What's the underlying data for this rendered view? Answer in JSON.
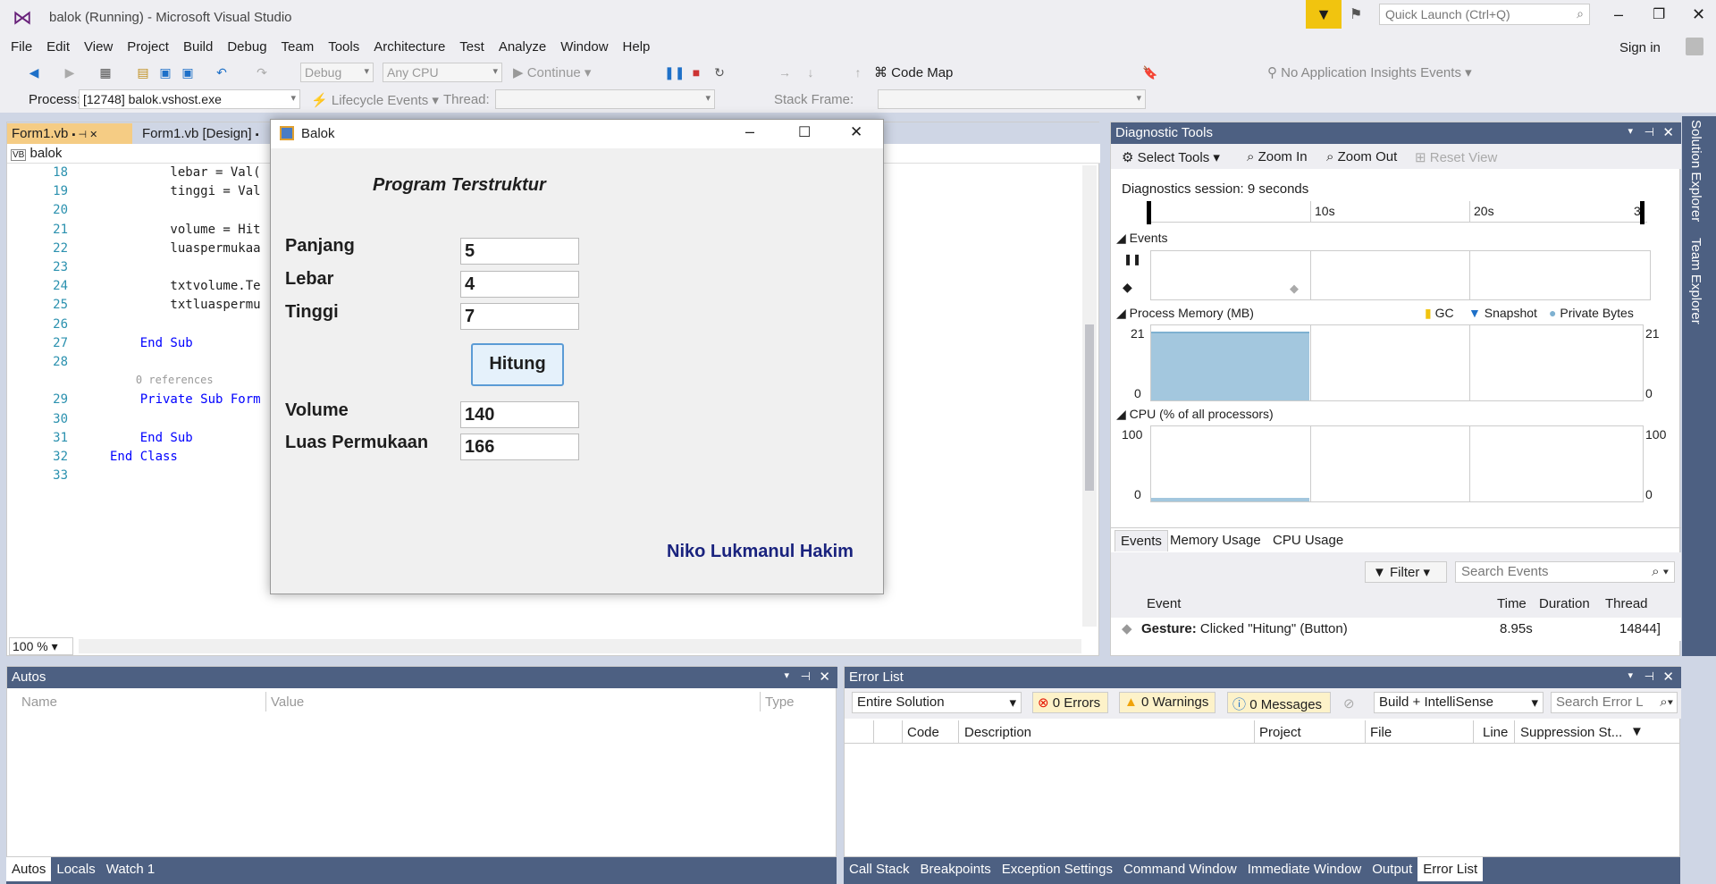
{
  "window": {
    "title": "balok (Running) - Microsoft Visual Studio",
    "quick_launch": "Quick Launch (Ctrl+Q)",
    "sign_in": "Sign in"
  },
  "menu": [
    "File",
    "Edit",
    "View",
    "Project",
    "Build",
    "Debug",
    "Team",
    "Tools",
    "Architecture",
    "Test",
    "Analyze",
    "Window",
    "Help"
  ],
  "toolbar": {
    "config": "Debug",
    "platform": "Any CPU",
    "continue": "Continue",
    "code_map": "Code Map",
    "insights": "No Application Insights Events"
  },
  "debugbar": {
    "process_label": "Process:",
    "process_value": "[12748] balok.vshost.exe",
    "lifecycle": "Lifecycle Events",
    "thread_label": "Thread:",
    "stack_label": "Stack Frame:"
  },
  "editor": {
    "tabs": [
      "Form1.vb",
      "Form1.vb [Design]"
    ],
    "nav_class": "balok",
    "zoom": "100 %",
    "lines": [
      {
        "n": "18",
        "t": "        lebar = Val("
      },
      {
        "n": "19",
        "t": "        tinggi = Val"
      },
      {
        "n": "20",
        "t": ""
      },
      {
        "n": "21",
        "t": "        volume = Hit"
      },
      {
        "n": "22",
        "t": "        luaspermukaa"
      },
      {
        "n": "23",
        "t": ""
      },
      {
        "n": "24",
        "t": "        txtvolume.Te"
      },
      {
        "n": "25",
        "t": "        txtluaspermu"
      },
      {
        "n": "26",
        "t": ""
      },
      {
        "n": "27",
        "t": "    End Sub"
      },
      {
        "n": "28",
        "t": ""
      },
      {
        "n": "",
        "t": "    0 references"
      },
      {
        "n": "29",
        "t": "    Private Sub Form"
      },
      {
        "n": "30",
        "t": ""
      },
      {
        "n": "31",
        "t": "    End Sub"
      },
      {
        "n": "32",
        "t": "End Class"
      },
      {
        "n": "33",
        "t": ""
      }
    ]
  },
  "dialog": {
    "title": "Balok",
    "heading": "Program Terstruktur",
    "fields": [
      {
        "label": "Panjang",
        "value": "5"
      },
      {
        "label": "Lebar",
        "value": "4"
      },
      {
        "label": "Tinggi",
        "value": "7"
      }
    ],
    "button": "Hitung",
    "outputs": [
      {
        "label": "Volume",
        "value": "140"
      },
      {
        "label": "Luas Permukaan",
        "value": "166"
      }
    ],
    "author": "Niko Lukmanul Hakim"
  },
  "diag": {
    "title": "Diagnostic Tools",
    "select_tools": "Select Tools",
    "zoom_in": "Zoom In",
    "zoom_out": "Zoom Out",
    "reset_view": "Reset View",
    "session": "Diagnostics session: 9 seconds",
    "ticks": [
      "10s",
      "20s",
      "3"
    ],
    "events": "Events",
    "memory": "Process Memory (MB)",
    "gc": "GC",
    "snapshot": "Snapshot",
    "private_bytes": "Private Bytes",
    "mem_max": "21",
    "mem_min": "0",
    "cpu": "CPU (% of all processors)",
    "cpu_max": "100",
    "cpu_min": "0",
    "tabs": [
      "Events",
      "Memory Usage",
      "CPU Usage"
    ],
    "filter": "Filter",
    "search": "Search Events",
    "cols": [
      "Event",
      "Time",
      "Duration",
      "Thread"
    ],
    "row": {
      "kind": "Gesture:",
      "text": " Clicked \"Hitung\" (Button)",
      "time": "8.95s",
      "thread": "14844]"
    }
  },
  "autos": {
    "title": "Autos",
    "cols": [
      "Name",
      "Value",
      "Type"
    ],
    "tabs": [
      "Autos",
      "Locals",
      "Watch 1"
    ]
  },
  "errors": {
    "title": "Error List",
    "scope": "Entire Solution",
    "errors": "0 Errors",
    "warnings": "0 Warnings",
    "messages": "0 Messages",
    "build": "Build + IntelliSense",
    "search": "Search Error L",
    "cols": [
      "Code",
      "Description",
      "Project",
      "File",
      "Line",
      "Suppression St..."
    ],
    "tabs": [
      "Call Stack",
      "Breakpoints",
      "Exception Settings",
      "Command Window",
      "Immediate Window",
      "Output",
      "Error List"
    ]
  },
  "side": {
    "solution_explorer": "Solution Explorer",
    "team_explorer": "Team Explorer"
  }
}
